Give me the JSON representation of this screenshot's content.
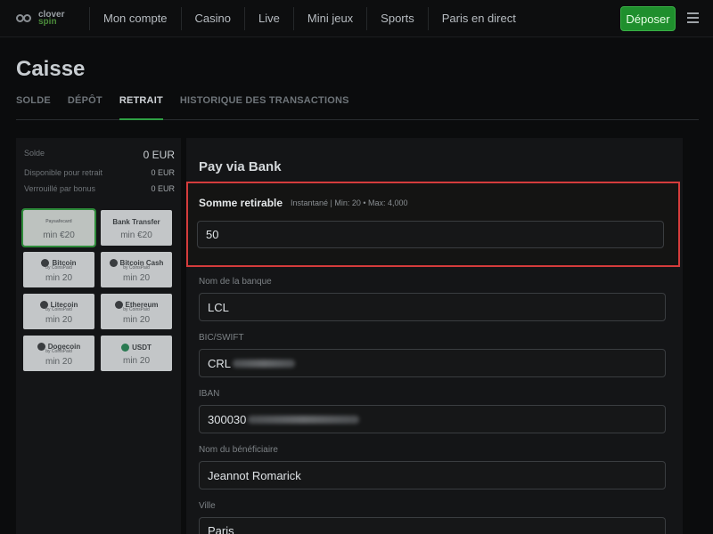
{
  "header": {
    "logo_top": "clover",
    "logo_bottom": "spin",
    "nav": [
      "Mon compte",
      "Casino",
      "Live",
      "Mini jeux",
      "Sports",
      "Paris en direct"
    ],
    "deposit_label": "Déposer"
  },
  "page": {
    "title": "Caisse",
    "tabs": [
      "SOLDE",
      "DÉPÔT",
      "RETRAIT",
      "HISTORIQUE DES TRANSACTIONS"
    ],
    "active_tab": "RETRAIT"
  },
  "balances": [
    {
      "label": "Solde",
      "value": "0 EUR"
    },
    {
      "label": "Disponible pour retrait",
      "value": "0 EUR"
    },
    {
      "label": "Verrouillé par bonus",
      "value": "0 EUR"
    }
  ],
  "methods": [
    {
      "name": "Paysafecard",
      "sub": "",
      "min": "min €20",
      "selected": true
    },
    {
      "name": "Bank Transfer",
      "sub": "",
      "min": "min €20",
      "selected": false
    },
    {
      "name": "Bitcoin",
      "sub": "by CoinsPaid",
      "min": "min 20",
      "selected": false
    },
    {
      "name": "Bitcoin Cash",
      "sub": "by CoinsPaid",
      "min": "min 20",
      "selected": false
    },
    {
      "name": "Litecoin",
      "sub": "by CoinsPaid",
      "min": "min 20",
      "selected": false
    },
    {
      "name": "Ethereum",
      "sub": "by CoinsPaid",
      "min": "min 20",
      "selected": false
    },
    {
      "name": "Dogecoin",
      "sub": "by CoinsPaid",
      "min": "min 20",
      "selected": false
    },
    {
      "name": "USDT",
      "sub": "",
      "min": "min 20",
      "selected": false
    }
  ],
  "form": {
    "title": "Pay via Bank",
    "amount_label": "Somme retirable",
    "amount_hint": "Instantané | Min: 20 • Max: 4,000",
    "amount_value": "50",
    "bank_label": "Nom de la banque",
    "bank_value": "LCL",
    "bic_label": "BIC/SWIFT",
    "bic_value": "CRL",
    "iban_label": "IBAN",
    "iban_value": "300030",
    "beneficiary_label": "Nom du bénéficiaire",
    "beneficiary_value": "Jeannot Romarick",
    "city_label": "Ville",
    "city_value": "Paris"
  },
  "colors": {
    "accent": "#1f8f2d",
    "highlight": "#d43c3c"
  }
}
